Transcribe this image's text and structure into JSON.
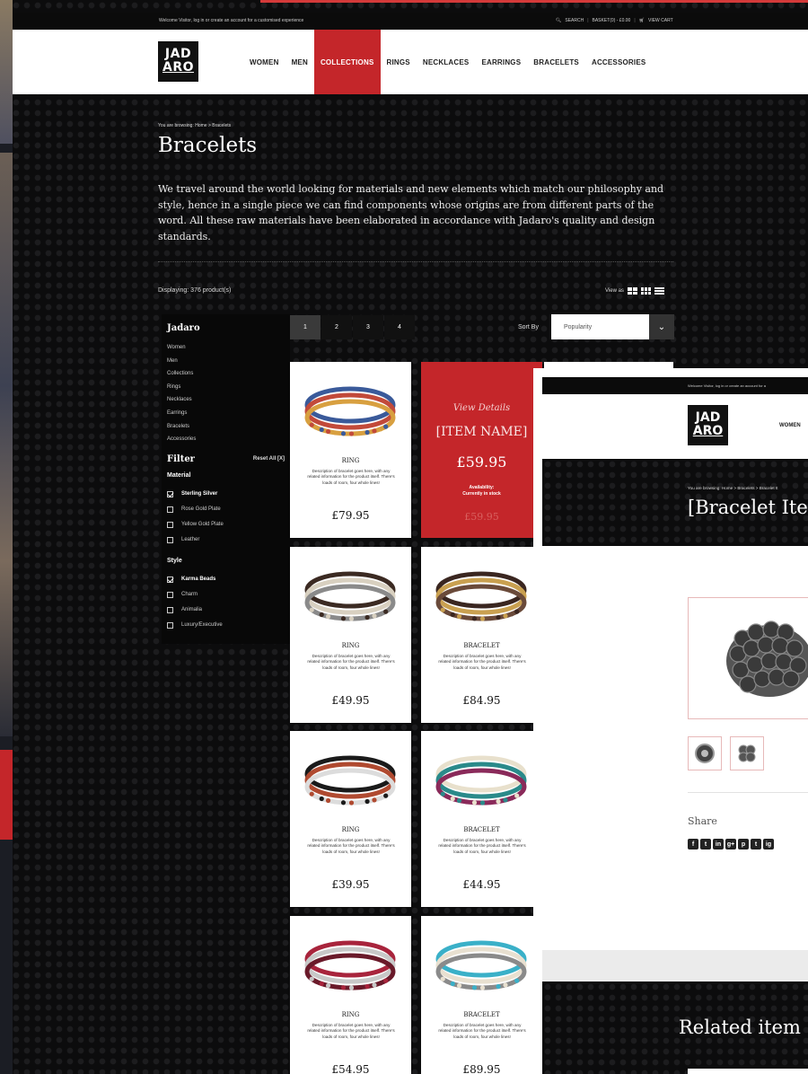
{
  "topbar": {
    "welcome": "Welcome Visitor, log in or create an account for a customised experience",
    "search": "SEARCH",
    "phone": "BASKET(0) - £0.00",
    "cart": "VIEW CART"
  },
  "brand": {
    "logo_line1": "JAD",
    "logo_line2": "ARO"
  },
  "nav": [
    "WOMEN",
    "MEN",
    "COLLECTIONS",
    "RINGS",
    "NECKLACES",
    "EARRINGS",
    "BRACELETS",
    "ACCESSORIES"
  ],
  "nav_active": "COLLECTIONS",
  "breadcrumb": "You are browsing: Home > Bracelets",
  "page_title": "Bracelets",
  "intro": "We travel around the world looking for materials and new elements which match our philosophy and style, hence in a single piece we can find components whose origins are from different parts of the word. All these raw materials have been elaborated in accordance with Jadaro's quality and design standards.",
  "displaying": "Displaying: 376 product(s)",
  "view_as": "View as",
  "pagination": [
    "1",
    "2",
    "3",
    "4"
  ],
  "sort": {
    "label": "Sort By",
    "value": "Popularity"
  },
  "sidebar": {
    "title": "Jadaro",
    "links": [
      "Women",
      "Men",
      "Collections",
      "Rings",
      "Necklaces",
      "Earrings",
      "Bracelets",
      "Accessories"
    ],
    "filter_title": "Filter",
    "reset": "Reset All [X]",
    "groups": [
      {
        "title": "Material",
        "options": [
          {
            "label": "Sterling Silver",
            "checked": true
          },
          {
            "label": "Rose Gold Plate",
            "checked": false
          },
          {
            "label": "Yellow Gold Plate",
            "checked": false
          },
          {
            "label": "Leather",
            "checked": false
          }
        ]
      },
      {
        "title": "Style",
        "options": [
          {
            "label": "Karma Beads",
            "checked": true
          },
          {
            "label": "Charm",
            "checked": false
          },
          {
            "label": "Animalia",
            "checked": false
          },
          {
            "label": "Luxury/Executive",
            "checked": false
          }
        ]
      }
    ]
  },
  "description_text": "Description of bracelet goes here, with any related information for the product itself. There's loads of room, four whole lines!",
  "hover_card": {
    "view_details": "View Details",
    "name": "[ITEM NAME]",
    "price": "£59.95",
    "availability_label": "Availability:",
    "availability_value": "Currently in stock",
    "ghost_price": "£59.95"
  },
  "products": [
    {
      "type": "RING",
      "price": "£79.95",
      "palette": [
        "#3a5a9a",
        "#c24a3a",
        "#d8a040"
      ]
    },
    {
      "type": "",
      "price": "",
      "palette": []
    },
    {
      "type": "RING",
      "price": "£49.95",
      "palette": [
        "#3b2a22",
        "#d8d0c0",
        "#8a8a8a"
      ]
    },
    {
      "type": "BRACELET",
      "price": "£84.95",
      "palette": [
        "#3a2620",
        "#c9a050",
        "#6a4a3a"
      ]
    },
    {
      "type": "RING",
      "price": "£39.95",
      "palette": [
        "#1a1a1a",
        "#b04a30",
        "#dcdcdc"
      ]
    },
    {
      "type": "BRACELET",
      "price": "£44.95",
      "palette": [
        "#e8e0cc",
        "#2a8a8a",
        "#8a2a5a"
      ]
    },
    {
      "type": "RING",
      "price": "£54.95",
      "palette": [
        "#a8243c",
        "#c8c8c8",
        "#6a1a2a"
      ]
    },
    {
      "type": "BRACELET",
      "price": "£89.95",
      "palette": [
        "#3ab0c8",
        "#e8e0d0",
        "#8a8a8a"
      ]
    }
  ],
  "detail": {
    "welcome": "Welcome Visitor, log in or create an account for a",
    "logo_line1": "JAD",
    "logo_line2": "ARO",
    "nav_first": "WOMEN",
    "breadcrumb": "You are browsing: Home > Bracelets > Bracelet It",
    "title": "[Bracelet Iter",
    "share": "Share",
    "social": [
      "f",
      "t",
      "in",
      "g+",
      "p",
      "t",
      "ig"
    ],
    "related": "Related item"
  },
  "colors": {
    "accent": "#c4262a",
    "background": "#0c0c0d"
  }
}
